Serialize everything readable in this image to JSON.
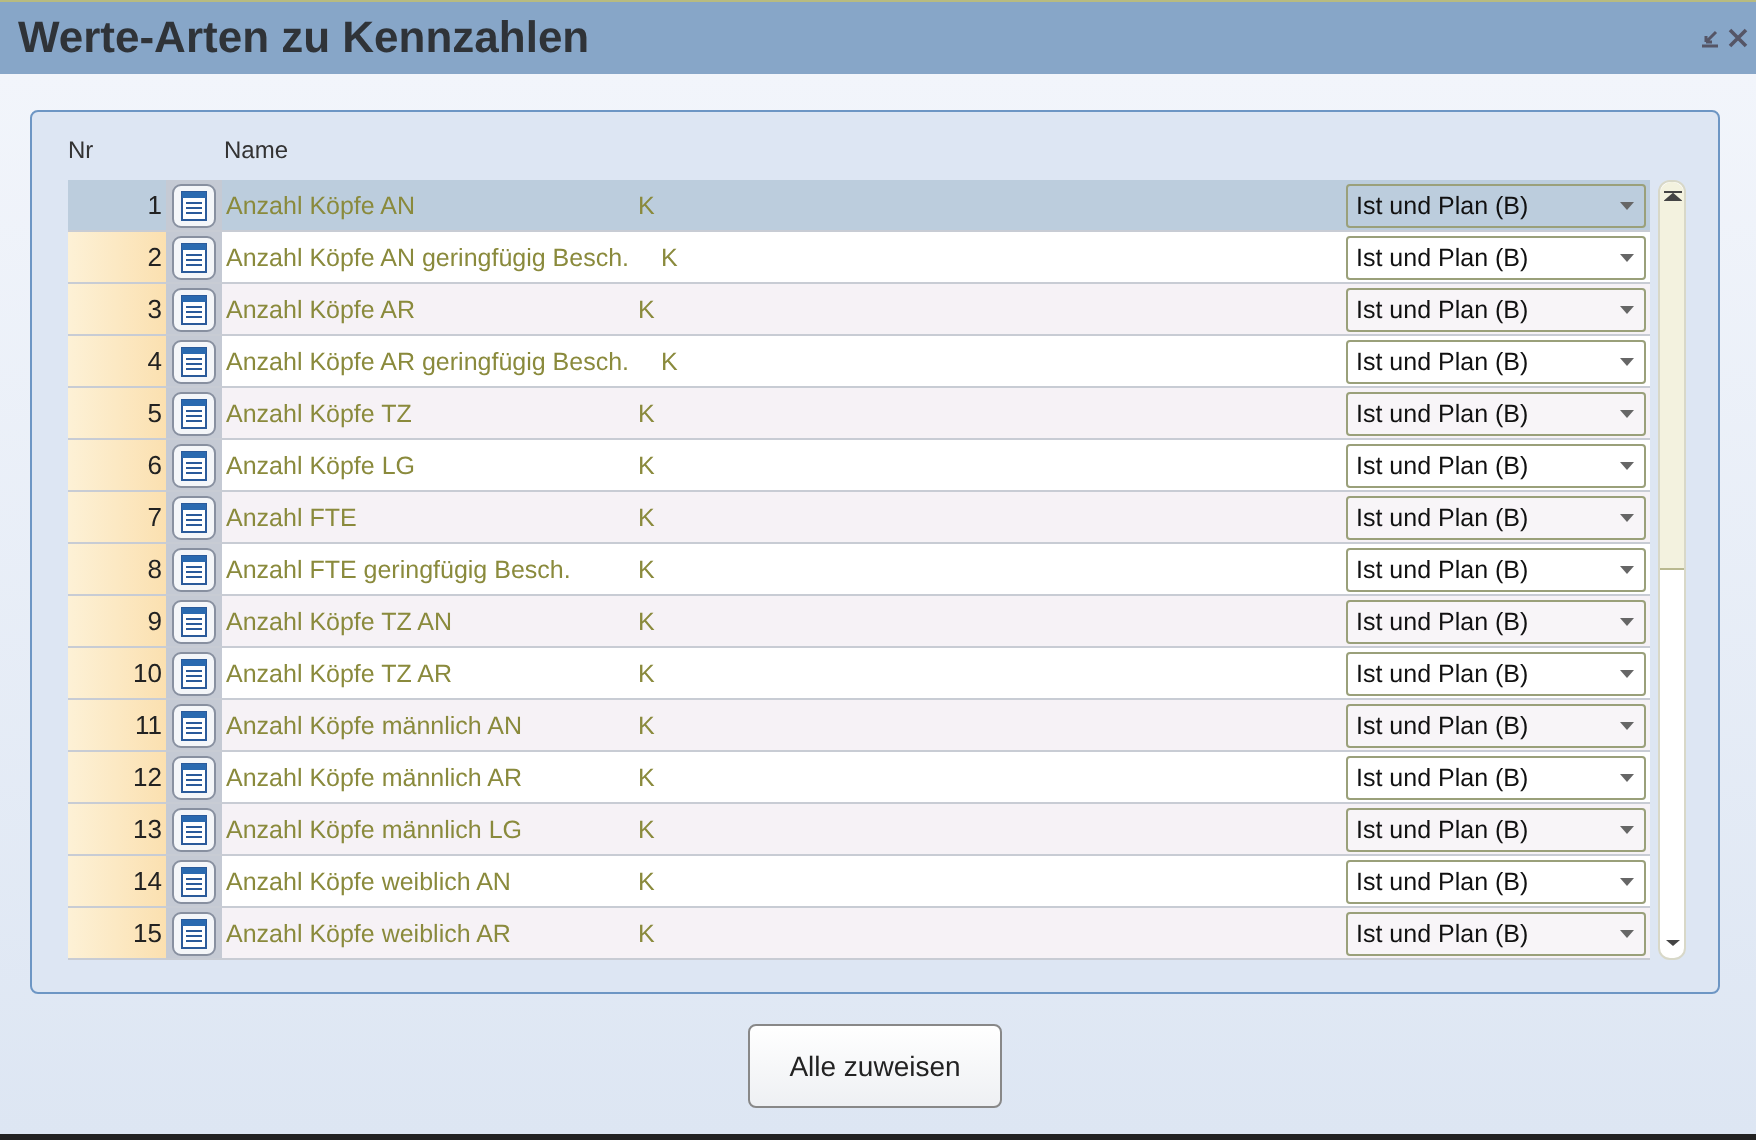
{
  "window": {
    "title": "Werte-Arten zu Kennzahlen"
  },
  "table": {
    "columns": [
      "Nr",
      "Name"
    ],
    "rows": [
      {
        "nr": "1",
        "name": "Anzahl Köpfe AN",
        "unit": "K",
        "value": "Ist und Plan (B)",
        "selected": true
      },
      {
        "nr": "2",
        "name": "Anzahl Köpfe AN geringfügig Besch.",
        "unit": "K",
        "value": "Ist und Plan (B)",
        "selected": false
      },
      {
        "nr": "3",
        "name": "Anzahl Köpfe AR",
        "unit": "K",
        "value": "Ist und Plan (B)",
        "selected": false
      },
      {
        "nr": "4",
        "name": "Anzahl Köpfe AR geringfügig Besch.",
        "unit": "K",
        "value": "Ist und Plan (B)",
        "selected": false
      },
      {
        "nr": "5",
        "name": "Anzahl Köpfe TZ",
        "unit": "K",
        "value": "Ist und Plan (B)",
        "selected": false
      },
      {
        "nr": "6",
        "name": "Anzahl Köpfe LG",
        "unit": "K",
        "value": "Ist und Plan (B)",
        "selected": false
      },
      {
        "nr": "7",
        "name": "Anzahl FTE",
        "unit": "K",
        "value": "Ist und Plan (B)",
        "selected": false
      },
      {
        "nr": "8",
        "name": "Anzahl FTE geringfügig Besch.",
        "unit": "K",
        "value": "Ist und Plan (B)",
        "selected": false
      },
      {
        "nr": "9",
        "name": "Anzahl Köpfe TZ AN",
        "unit": "K",
        "value": "Ist und Plan (B)",
        "selected": false
      },
      {
        "nr": "10",
        "name": "Anzahl Köpfe TZ AR",
        "unit": "K",
        "value": "Ist und Plan (B)",
        "selected": false
      },
      {
        "nr": "11",
        "name": "Anzahl Köpfe männlich AN",
        "unit": "K",
        "value": "Ist und Plan (B)",
        "selected": false
      },
      {
        "nr": "12",
        "name": "Anzahl Köpfe männlich AR",
        "unit": "K",
        "value": "Ist und Plan (B)",
        "selected": false
      },
      {
        "nr": "13",
        "name": "Anzahl Köpfe männlich LG",
        "unit": "K",
        "value": "Ist und Plan (B)",
        "selected": false
      },
      {
        "nr": "14",
        "name": "Anzahl Köpfe weiblich AN",
        "unit": "K",
        "value": "Ist und Plan (B)",
        "selected": false
      },
      {
        "nr": "15",
        "name": "Anzahl Köpfe weiblich AR",
        "unit": "K",
        "value": "Ist und Plan (B)",
        "selected": false
      }
    ]
  },
  "buttons": [
    "Alle zuweisen"
  ]
}
